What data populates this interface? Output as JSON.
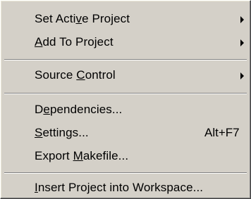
{
  "menu": {
    "items": [
      {
        "pre": "Set Acti",
        "key": "v",
        "post": "e Project",
        "shortcut": "",
        "submenu": true
      },
      {
        "pre": "",
        "key": "A",
        "post": "dd To Project",
        "shortcut": "",
        "submenu": true
      },
      {
        "pre": "Source ",
        "key": "C",
        "post": "ontrol",
        "shortcut": "",
        "submenu": true
      },
      {
        "pre": "D",
        "key": "e",
        "post": "pendencies...",
        "shortcut": "",
        "submenu": false
      },
      {
        "pre": "",
        "key": "S",
        "post": "ettings...",
        "shortcut": "Alt+F7",
        "submenu": false
      },
      {
        "pre": "Export ",
        "key": "M",
        "post": "akefile...",
        "shortcut": "",
        "submenu": false
      },
      {
        "pre": "",
        "key": "I",
        "post": "nsert Project into Workspace...",
        "shortcut": "",
        "submenu": false
      }
    ]
  },
  "colors": {
    "menu_bg": "#d4d0c8",
    "text": "#000000",
    "separator_dark": "#808080",
    "separator_light": "#ffffff"
  }
}
